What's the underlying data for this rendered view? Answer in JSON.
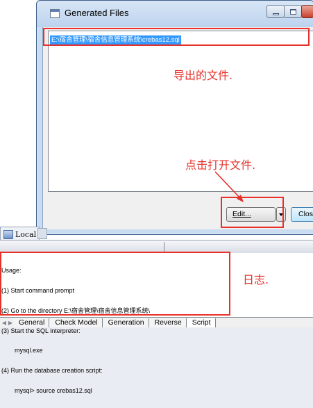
{
  "dialog": {
    "title": "Generated Files",
    "file_path": "E:\\宿舍管理\\宿舍信息管理系统\\crebas12.sql",
    "annotation_export": "导出的文件.",
    "annotation_open": "点击打开文件.",
    "edit_label": "Edit...",
    "close_label": "Clos"
  },
  "local_tab": {
    "label": "Local"
  },
  "log": {
    "lines": [
      "Usage:",
      "(1) Start command prompt",
      "(2) Go to the directory E:\\宿舍管理\\宿舍信息管理系统\\",
      "(3) Start the SQL interpreter:",
      "    mysql.exe",
      "(4) Run the database creation script:",
      "    mysql> source crebas12.sql"
    ],
    "annotation": "日志."
  },
  "bottom_tabs": [
    "General",
    "Check Model",
    "Generation",
    "Reverse",
    "Script"
  ],
  "colors": {
    "annotation_red": "#e5302a",
    "selection_blue": "#3399ff"
  }
}
